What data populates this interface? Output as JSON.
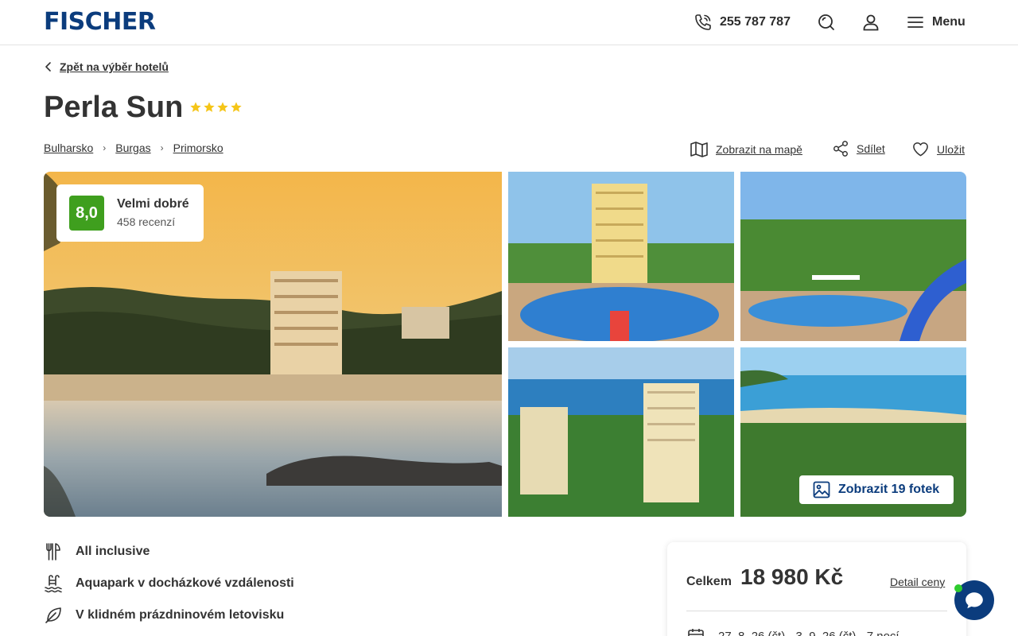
{
  "header": {
    "logo": "FISCHER",
    "phone": "255 787 787",
    "menu_label": "Menu",
    "icons": [
      "phone-icon",
      "search-icon",
      "user-icon",
      "hamburger-icon"
    ]
  },
  "back_link": "Zpět na výběr hotelů",
  "hotel": {
    "name": "Perla Sun",
    "stars": 4
  },
  "breadcrumb": [
    "Bulharsko",
    "Burgas",
    "Primorsko"
  ],
  "actions": {
    "map": "Zobrazit na mapě",
    "share": "Sdílet",
    "save": "Uložit"
  },
  "rating": {
    "score": "8,0",
    "label": "Velmi dobré",
    "reviews": "458 recenzí"
  },
  "gallery": {
    "button": "Zobrazit 19 fotek"
  },
  "features": [
    {
      "icon": "cutlery-icon",
      "text": "All inclusive"
    },
    {
      "icon": "pool-icon",
      "text": "Aquapark v docházkové vzdálenosti"
    },
    {
      "icon": "leaf-icon",
      "text": "V klidném prázdninovém letovisku"
    }
  ],
  "price_card": {
    "total_label": "Celkem",
    "price": "18 980 Kč",
    "detail_link": "Detail ceny",
    "dates": "27. 8. 26 (čt) - 3. 9. 26 (čt) · 7 nocí"
  },
  "colors": {
    "brand": "#0b3c7d",
    "rating": "#3f9f1e",
    "star": "#f5c518",
    "chat_online": "#2ecc2e"
  }
}
